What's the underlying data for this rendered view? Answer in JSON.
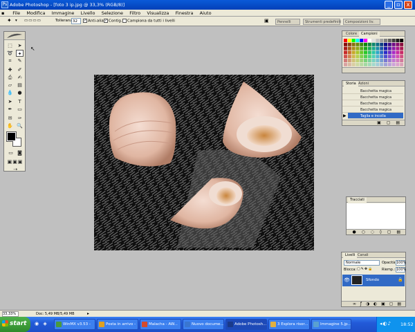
{
  "app": {
    "title": "Adobe Photoshop - [foto 3 ip.jpg @ 33,3% (RGB/8)]",
    "icon": "photoshop-icon"
  },
  "window_buttons": {
    "minimize": "_",
    "restore": "▫",
    "close": "x"
  },
  "menu": [
    "File",
    "Modifica",
    "Immagine",
    "Livello",
    "Selezione",
    "Filtro",
    "Visualizza",
    "Finestra",
    "Aiuto"
  ],
  "options": {
    "tolerance_label": "Tolleranza:",
    "tolerance_value": "32",
    "antialias_label": "Anti-alias",
    "contiguous_label": "Contig.",
    "all_layers_label": "Campiona da tutti i livelli",
    "well_tabs": [
      "Pennelli",
      "Strumenti predefiniti",
      "Composizioni liv."
    ]
  },
  "color_panel": {
    "tabs": [
      "Colore",
      "Campioni"
    ],
    "active": "Campioni"
  },
  "history_panel": {
    "tabs": [
      "Storia",
      "Azioni"
    ],
    "items": [
      "Bacchetta magica",
      "Bacchetta magica",
      "Bacchetta magica",
      "Bacchetta magica",
      "Taglia e incolla"
    ],
    "selected_index": 4
  },
  "paths_panel": {
    "tabs": [
      "Tracciati"
    ]
  },
  "layers_panel": {
    "tabs": [
      "Livelli",
      "Canali"
    ],
    "blend_mode": "Normale",
    "opacity_label": "Opacità:",
    "opacity": "100%",
    "fill_label": "Riemp.:",
    "fill": "100%",
    "lock_label": "Blocca:",
    "layers": [
      {
        "name": "Sfondo"
      }
    ]
  },
  "status": {
    "zoom": "33,33%",
    "doc": "Doc: 5,49 MB/5,49 MB"
  },
  "taskbar": {
    "start": "start",
    "items": [
      {
        "label": "WinMX v3.53 -",
        "color": "#4a9a3e"
      },
      {
        "label": "Posta in arrivo -",
        "color": "#e0a020"
      },
      {
        "label": "Malacha - AW...",
        "color": "#d44b2a"
      },
      {
        "label": "Nuovo docume...",
        "color": "#3a76d0"
      },
      {
        "label": "Adobe Photosh...",
        "color": "#1a3a8a"
      },
      {
        "label": "3 Esplora risor...",
        "color": "#e0b040"
      },
      {
        "label": "Immagine 5.jp...",
        "color": "#5aa0d0"
      }
    ],
    "clock": "18:52"
  },
  "colors": {
    "accent": "#316ac5",
    "canvas_bg": "#c0c0c0",
    "taskbar": "#225ad8"
  }
}
